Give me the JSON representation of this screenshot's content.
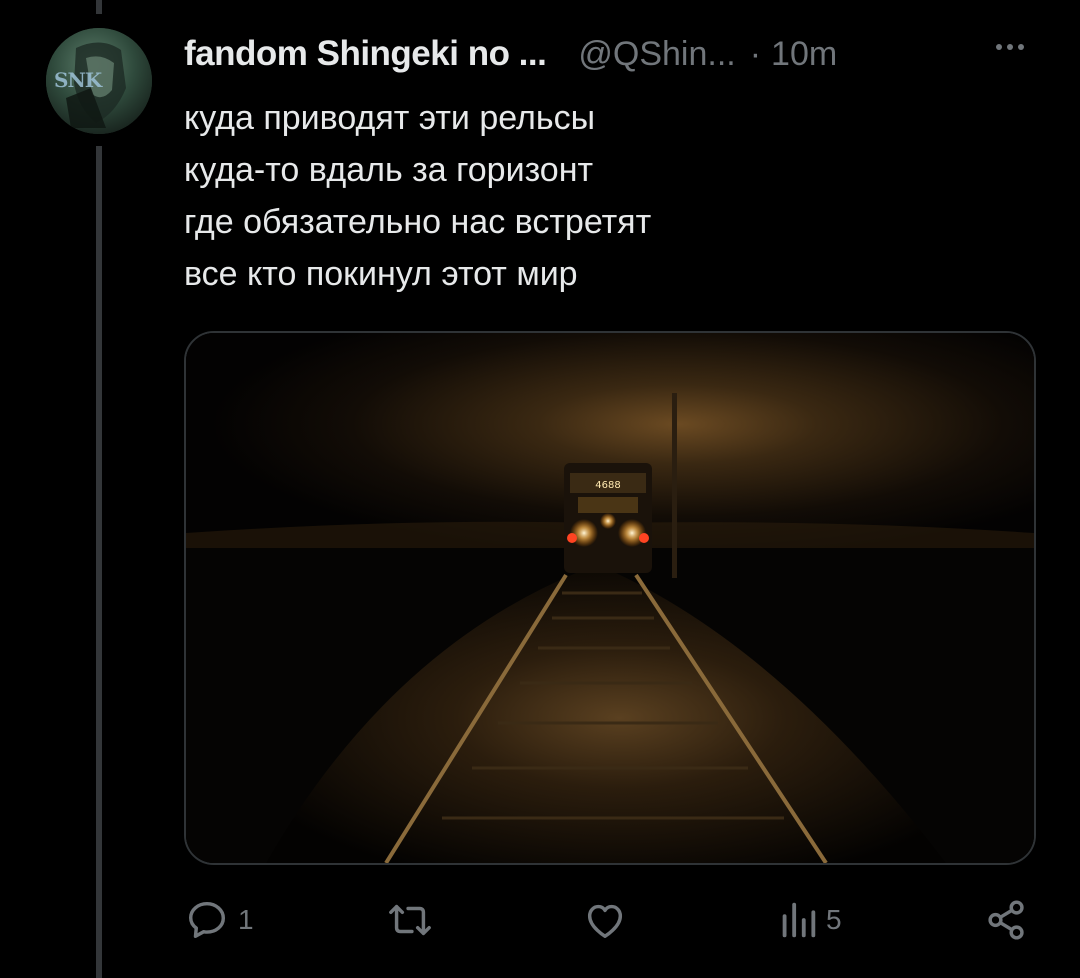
{
  "tweet": {
    "display_name": "fandom Shingeki no ...",
    "handle": "@QShin...",
    "separator": "·",
    "time": "10m",
    "avatar_text": "SNK",
    "lines": [
      "куда приводят эти рельсы",
      "куда-то вдаль за горизонт",
      "где обязательно нас встретят",
      "все кто покинул этот мир"
    ],
    "media": {
      "description_icon": "train-photo",
      "locomotive_sign": "4688"
    }
  },
  "actions": {
    "reply_count": "1",
    "retweet_count": "",
    "like_count": "",
    "views_count": "5",
    "share_count": ""
  },
  "colors": {
    "background": "#000000",
    "text_primary": "#e7e9ea",
    "text_secondary": "#71767b",
    "border": "#2f3336",
    "thread_line": "#333639"
  }
}
